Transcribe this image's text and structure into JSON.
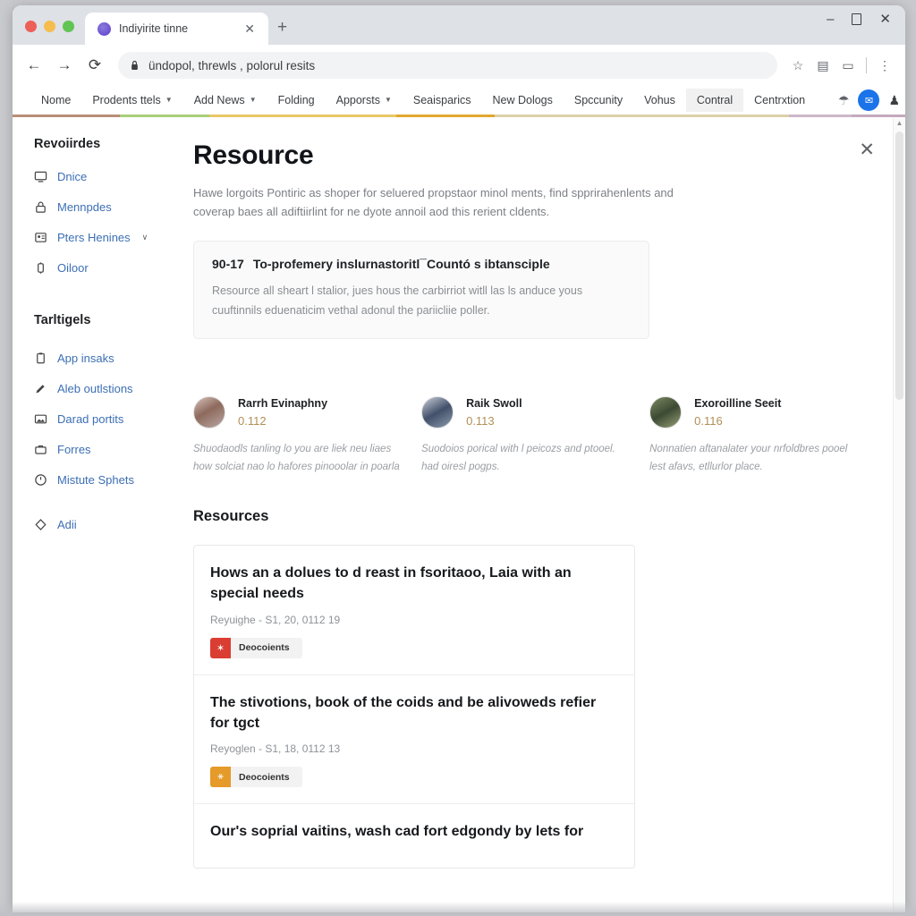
{
  "browser": {
    "tab": {
      "title": "Indiyirite tinne",
      "favicon": "globe-icon",
      "close": "✕"
    },
    "new_tab": "+",
    "window_controls": {
      "minimize": "–",
      "maximize": "□",
      "close": "✕"
    },
    "toolbar": {
      "back": "←",
      "forward": "→",
      "reload": "⟳",
      "url": "ündopol, threwls , polorul resits",
      "lock": "lock-icon",
      "star": "☆",
      "extensions": "▤",
      "cast": "▭",
      "menu": "⋮"
    }
  },
  "sitenav": {
    "items": [
      {
        "label": "Nome",
        "caret": false,
        "active": false
      },
      {
        "label": "Prodents ttels",
        "caret": true,
        "active": false
      },
      {
        "label": "Add News",
        "caret": true,
        "active": false
      },
      {
        "label": "Folding",
        "caret": false,
        "active": false
      },
      {
        "label": "Apporsts",
        "caret": true,
        "active": false
      },
      {
        "label": "Seaisparics",
        "caret": false,
        "active": false
      },
      {
        "label": "New Dologs",
        "caret": false,
        "active": false
      },
      {
        "label": "Spccunity",
        "caret": false,
        "active": false
      },
      {
        "label": "Vohus",
        "caret": false,
        "active": false
      },
      {
        "label": "Contral",
        "caret": false,
        "active": true
      },
      {
        "label": "Centrxtion",
        "caret": false,
        "active": false
      }
    ],
    "right": {
      "shield": "shield-icon",
      "profile": "profile-avatar",
      "bell": "bell-icon"
    },
    "stripe_colors": [
      "#b98e7a",
      "#a8cf7a",
      "#e8c766",
      "#e0a82e",
      "#ddd0a8",
      "#cbb8c9",
      "#c5a9bd"
    ]
  },
  "sidebar": {
    "section1_title": "Revoiirdes",
    "section1_items": [
      {
        "label": "Dnice",
        "icon": "monitor-icon",
        "chevron": false
      },
      {
        "label": "Mennpdes",
        "icon": "lock-icon",
        "chevron": false
      },
      {
        "label": "Pters Henines",
        "icon": "id-card-icon",
        "chevron": true
      },
      {
        "label": "Oiloor",
        "icon": "battery-icon",
        "chevron": false
      }
    ],
    "section2_title": "Tarltigels",
    "section2_items": [
      {
        "label": "App insaks",
        "icon": "clipboard-icon",
        "chevron": false
      },
      {
        "label": "Aleb outlstions",
        "icon": "pencil-icon",
        "chevron": false
      },
      {
        "label": "Darad portits",
        "icon": "image-icon",
        "chevron": false
      },
      {
        "label": "Forres",
        "icon": "briefcase-icon",
        "chevron": false
      },
      {
        "label": "Mistute Sphets",
        "icon": "clock-icon",
        "chevron": false
      }
    ],
    "section3_items": [
      {
        "label": "Adii",
        "icon": "diamond-icon",
        "chevron": false
      }
    ]
  },
  "main": {
    "close_label": "✕",
    "title": "Resource",
    "lede": "Hawe lorgoits Pontiric as shoper for seluered propstaor minol ments, find spprirahenlents and coverap baes all adiftiirlint for ne dyote annoil aod this rerient cldents.",
    "notice": {
      "number": "90-17",
      "heading": "To-profemery inslurnastoritl¯Countó s ibtansciple",
      "body": "Resource all sheart l stalior, jues hous the carbirriot witll las ls anduce yous cuuftinnils eduenaticim vethal adonul the pariicliie poller."
    },
    "people_section": {
      "people": [
        {
          "name": "Rarrh Evinaphny",
          "score": "0.112",
          "note": "Shuodaodls tanling lo you are liek neu liaes how solciat nao lo hafores pinooolar in poarla",
          "avatar": "person-avatar-1"
        },
        {
          "name": "Raik Swoll",
          "score": "0.113",
          "note": "Suodoios porical with l peicozs and ptooel. had oiresl pogps.",
          "avatar": "person-avatar-2"
        },
        {
          "name": "Exoroilline Seeit",
          "score": "0.116",
          "note": "Nonnatien aftanalater your nrfoldbres pooel lest afavs, etllurlor place.",
          "avatar": "person-avatar-3"
        }
      ]
    },
    "resources_heading": "Resources",
    "resources": [
      {
        "title": "Hows an a dolues to d reast in fsoritaoo, Laia with an special needs",
        "meta": "Reyuighe - S1, 20, 0112 19",
        "chip_label": "Deocoients",
        "chip_icon": "✶",
        "chip_color": "#da3d32"
      },
      {
        "title": "The stivotions, book of the coids and be alivoweds refier for tgct",
        "meta": "Reyoglen - S1, 18, 0112 13",
        "chip_label": "Deocoients",
        "chip_icon": "⚹",
        "chip_color": "#e59a29"
      },
      {
        "title": "Our's soprial vaitins, wash cad fort edgondy by lets for",
        "meta": "",
        "chip_label": "",
        "chip_icon": "",
        "chip_color": ""
      }
    ],
    "scrollbar": {
      "up_arrow": "▲"
    }
  }
}
